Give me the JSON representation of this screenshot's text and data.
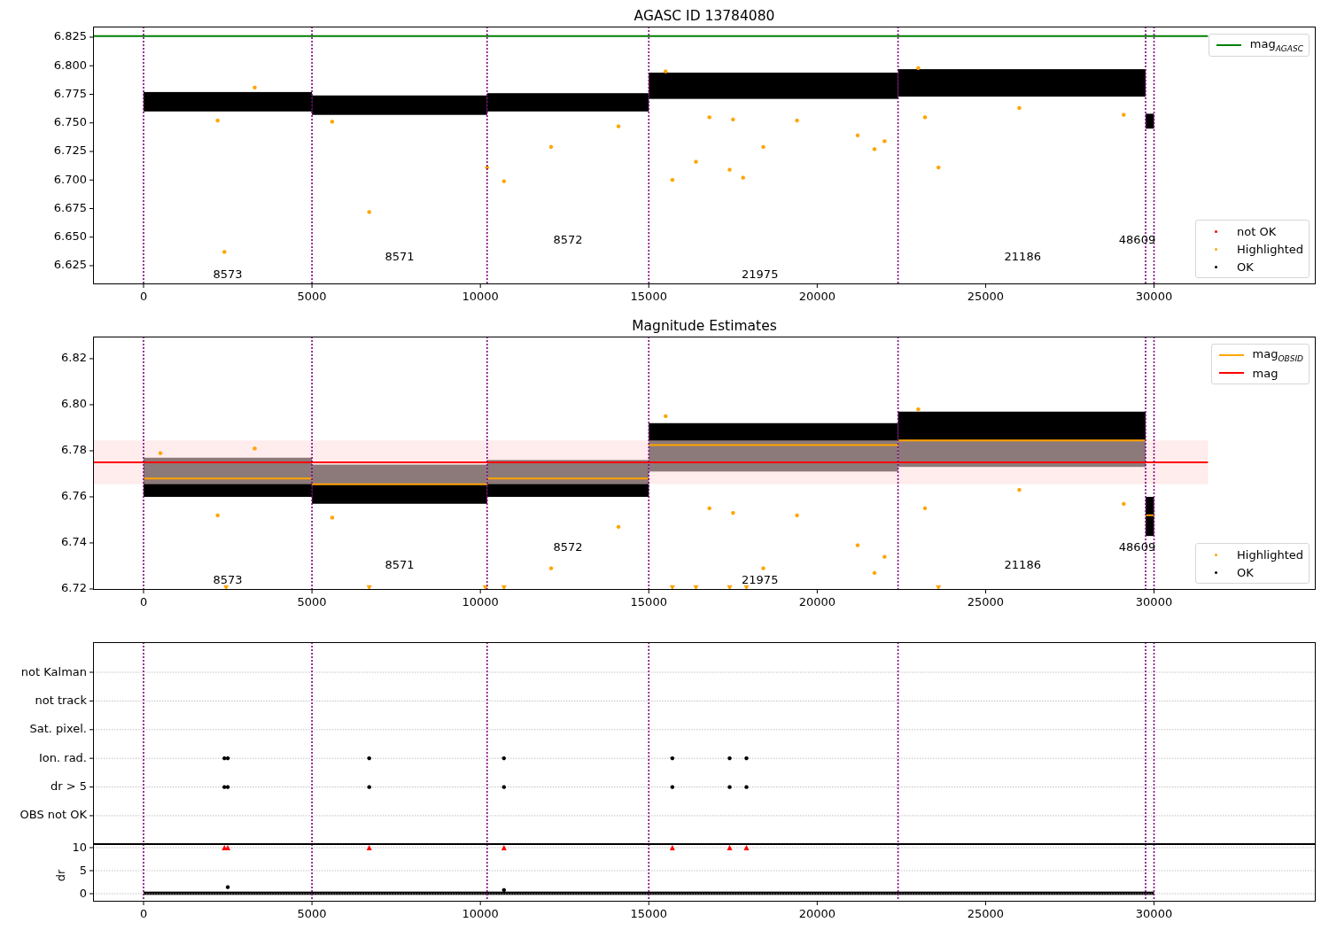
{
  "panels": [
    {
      "chart_data": {
        "type": "scatter",
        "title": "AGASC ID 13784080",
        "xlim": [
          -1500,
          34800
        ],
        "ylim": [
          6.6087,
          6.8343
        ],
        "xticks": [
          0,
          5000,
          10000,
          15000,
          20000,
          25000,
          30000
        ],
        "yticks": [
          {
            "value": 6.625,
            "label": "6.625"
          },
          {
            "value": 6.65,
            "label": "6.650"
          },
          {
            "value": 6.675,
            "label": "6.675"
          },
          {
            "value": 6.7,
            "label": "6.700"
          },
          {
            "value": 6.725,
            "label": "6.725"
          },
          {
            "value": 6.75,
            "label": "6.750"
          },
          {
            "value": 6.775,
            "label": "6.775"
          },
          {
            "value": 6.8,
            "label": "6.800"
          },
          {
            "value": 6.825,
            "label": "6.825"
          }
        ],
        "series": [
          {
            "name": "mag$_{AGASC}$",
            "type": "line",
            "color": "#008000",
            "x": [
              -1500,
              31600
            ],
            "values": [
              6.826,
              6.826
            ]
          },
          {
            "name": "not OK",
            "color": "#ff0000"
          },
          {
            "name": "Highlighted",
            "color": "#ffa500",
            "x": [
              2400,
              6700,
              10200,
              10700,
              12100,
              14100,
              15700,
              16400,
              16800,
              17400,
              17500,
              17800,
              18400,
              19400,
              21200,
              21700,
              22000,
              23200,
              23600,
              2200,
              5600,
              26000,
              29100,
              3300,
              15500,
              23000
            ],
            "values": [
              6.637,
              6.672,
              6.711,
              6.699,
              6.729,
              6.747,
              6.7,
              6.716,
              6.755,
              6.709,
              6.753,
              6.702,
              6.729,
              6.752,
              6.739,
              6.727,
              6.734,
              6.755,
              6.711,
              6.752,
              6.751,
              6.763,
              6.757,
              6.781,
              6.795,
              6.798
            ]
          },
          {
            "name": "OK",
            "color": "#000000"
          }
        ],
        "ref_lines": [
          {
            "axis": "x",
            "value": 0,
            "color": "#800080"
          },
          {
            "axis": "x",
            "value": 5000,
            "color": "#800080"
          },
          {
            "axis": "x",
            "value": 10200,
            "color": "#800080"
          },
          {
            "axis": "x",
            "value": 15000,
            "color": "#800080"
          },
          {
            "axis": "x",
            "value": 22400,
            "color": "#800080"
          },
          {
            "axis": "x",
            "value": 29750,
            "color": "#800080"
          },
          {
            "axis": "x",
            "value": 30000,
            "color": "#800080"
          }
        ],
        "annotations": [
          "8573",
          "8571",
          "8572",
          "21975",
          "21186",
          "48609"
        ]
      }
    },
    {
      "chart_data": {
        "type": "scatter",
        "title": "Magnitude Estimates",
        "xlim": [
          -1500,
          34800
        ],
        "ylim": [
          6.7196,
          6.8296
        ],
        "xticks": [
          0,
          5000,
          10000,
          15000,
          20000,
          25000,
          30000
        ],
        "yticks": [
          {
            "value": 6.72,
            "label": "6.72"
          },
          {
            "value": 6.74,
            "label": "6.74"
          },
          {
            "value": 6.76,
            "label": "6.76"
          },
          {
            "value": 6.78,
            "label": "6.78"
          },
          {
            "value": 6.8,
            "label": "6.80"
          },
          {
            "value": 6.82,
            "label": "6.82"
          }
        ],
        "series": [
          {
            "name": "mag$_{OBSID}$",
            "type": "line",
            "color": "#ffa500",
            "x": [
              0,
              5000,
              5000,
              10200,
              10200,
              15000,
              15000,
              22400,
              22400,
              29750,
              29750,
              30000
            ],
            "values": [
              6.768,
              6.768,
              6.7655,
              6.7655,
              6.768,
              6.768,
              6.7825,
              6.7825,
              6.7845,
              6.7845,
              6.752,
              6.752
            ]
          },
          {
            "name": "mag",
            "type": "line",
            "color": "#ff0000",
            "x": [
              -1500,
              31600
            ],
            "values": [
              6.775,
              6.775
            ]
          },
          {
            "name": "Highlighted",
            "color": "#ffa500",
            "x": [
              12100,
              14100,
              18400,
              19400,
              21200,
              21700,
              22000,
              23200,
              16800,
              17500,
              5600,
              2200,
              26000,
              29100,
              3300,
              15500,
              23000,
              500
            ],
            "values": [
              6.729,
              6.747,
              6.729,
              6.752,
              6.739,
              6.727,
              6.734,
              6.755,
              6.755,
              6.753,
              6.751,
              6.752,
              6.763,
              6.757,
              6.781,
              6.795,
              6.798,
              6.779
            ]
          },
          {
            "name": "OK",
            "color": "#000000"
          },
          {
            "color": "#ffa500",
            "marker": "v",
            "x": [
              2450,
              6700,
              10150,
              10700,
              15700,
              16400,
              17400,
              17900,
              23600
            ],
            "values": [
              6.7205,
              6.7205,
              6.7205,
              6.7205,
              6.7205,
              6.7205,
              6.7205,
              6.7205,
              6.7205
            ]
          }
        ],
        "bands": [
          {
            "axis": "y",
            "from": 6.7655,
            "to": 6.7845,
            "color": "#ffdddd"
          }
        ],
        "ref_lines": [
          {
            "axis": "x",
            "value": 0,
            "color": "#800080"
          },
          {
            "axis": "x",
            "value": 5000,
            "color": "#800080"
          },
          {
            "axis": "x",
            "value": 10200,
            "color": "#800080"
          },
          {
            "axis": "x",
            "value": 15000,
            "color": "#800080"
          },
          {
            "axis": "x",
            "value": 22400,
            "color": "#800080"
          },
          {
            "axis": "x",
            "value": 29750,
            "color": "#800080"
          },
          {
            "axis": "x",
            "value": 30000,
            "color": "#800080"
          }
        ],
        "annotations": [
          "8573",
          "8571",
          "8572",
          "21975",
          "21186",
          "48609"
        ]
      }
    },
    {
      "chart_data": {
        "type": "scatter",
        "orientation": "horizontal",
        "grid": true,
        "xlim": [
          -1500,
          34800
        ],
        "categories": [
          "not Kalman",
          "not track",
          "Sat. pixel.",
          "Ion. rad.",
          "dr > 5",
          "OBS not OK"
        ],
        "series": [
          {
            "color": "#000000",
            "values": [
              null,
              null,
              null,
              2400,
              2400,
              null
            ]
          },
          {
            "color": "#000000",
            "values": [
              null,
              null,
              null,
              2500,
              2500,
              null
            ]
          },
          {
            "color": "#000000",
            "values": [
              null,
              null,
              null,
              6700,
              6700,
              null
            ]
          },
          {
            "color": "#000000",
            "values": [
              null,
              null,
              null,
              10700,
              10700,
              null
            ]
          },
          {
            "color": "#000000",
            "values": [
              null,
              null,
              null,
              15700,
              15700,
              null
            ]
          },
          {
            "color": "#000000",
            "values": [
              null,
              null,
              null,
              17400,
              17400,
              null
            ]
          },
          {
            "color": "#000000",
            "values": [
              null,
              null,
              null,
              17900,
              17900,
              null
            ]
          }
        ],
        "ref_lines": [
          {
            "axis": "x",
            "value": 0,
            "color": "#800080"
          },
          {
            "axis": "x",
            "value": 5000,
            "color": "#800080"
          },
          {
            "axis": "x",
            "value": 10200,
            "color": "#800080"
          },
          {
            "axis": "x",
            "value": 15000,
            "color": "#800080"
          },
          {
            "axis": "x",
            "value": 22400,
            "color": "#800080"
          },
          {
            "axis": "x",
            "value": 29750,
            "color": "#800080"
          },
          {
            "axis": "x",
            "value": 30000,
            "color": "#800080"
          }
        ]
      }
    },
    {
      "chart_data": {
        "type": "scatter",
        "ylabel": "dr",
        "grid": true,
        "xlim": [
          -1500,
          34800
        ],
        "ylim": [
          -1.73,
          10.77
        ],
        "xticks": [
          0,
          5000,
          10000,
          15000,
          20000,
          25000,
          30000
        ],
        "yticks": [
          0,
          5,
          10
        ],
        "series": [
          {
            "color": "#ff0000",
            "marker": "^",
            "x": [
              2400,
              2500,
              6700,
              10700,
              15700,
              17400,
              17900
            ],
            "values": [
              10,
              10,
              10,
              10,
              10,
              10,
              10
            ]
          },
          {
            "color": "#000000",
            "x": [
              2500,
              10700
            ],
            "values": [
              1.4,
              0.8
            ]
          }
        ],
        "ref_lines": [
          {
            "axis": "x",
            "value": 0,
            "color": "#800080"
          },
          {
            "axis": "x",
            "value": 5000,
            "color": "#800080"
          },
          {
            "axis": "x",
            "value": 10200,
            "color": "#800080"
          },
          {
            "axis": "x",
            "value": 15000,
            "color": "#800080"
          },
          {
            "axis": "x",
            "value": 22400,
            "color": "#800080"
          },
          {
            "axis": "x",
            "value": 29750,
            "color": "#800080"
          },
          {
            "axis": "x",
            "value": 30000,
            "color": "#800080"
          }
        ]
      }
    }
  ]
}
